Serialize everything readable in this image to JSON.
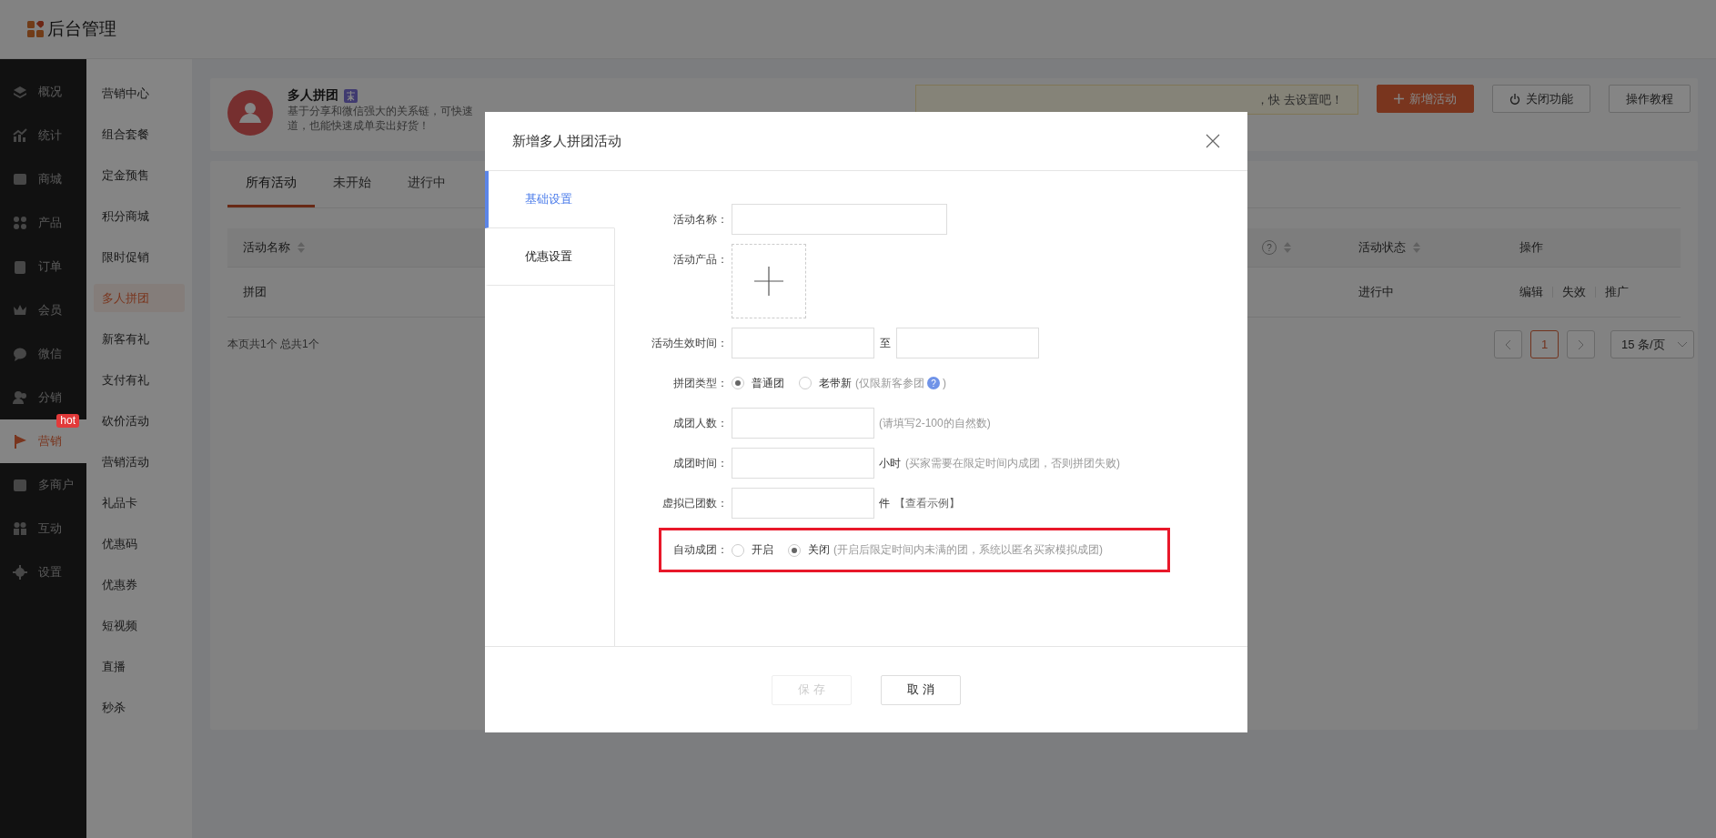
{
  "header": {
    "logo_text": "后台管理"
  },
  "sidebar": {
    "items": [
      {
        "label": "概况",
        "selected": false
      },
      {
        "label": "统计",
        "selected": false
      },
      {
        "label": "商城",
        "selected": false
      },
      {
        "label": "产品",
        "selected": false
      },
      {
        "label": "订单",
        "selected": false
      },
      {
        "label": "会员",
        "selected": false
      },
      {
        "label": "微信",
        "selected": false
      },
      {
        "label": "分销",
        "selected": false
      },
      {
        "label": "营销",
        "selected": true,
        "badge": "hot"
      },
      {
        "label": "多商户",
        "selected": false
      },
      {
        "label": "互动",
        "selected": false
      },
      {
        "label": "设置",
        "selected": false
      }
    ]
  },
  "submenu": {
    "items": [
      {
        "label": "营销中心",
        "selected": false
      },
      {
        "label": "组合套餐",
        "selected": false
      },
      {
        "label": "定金预售",
        "selected": false
      },
      {
        "label": "积分商城",
        "selected": false
      },
      {
        "label": "限时促销",
        "selected": false
      },
      {
        "label": "多人拼团",
        "selected": true
      },
      {
        "label": "新客有礼",
        "selected": false
      },
      {
        "label": "支付有礼",
        "selected": false
      },
      {
        "label": "砍价活动",
        "selected": false
      },
      {
        "label": "营销活动",
        "selected": false
      },
      {
        "label": "礼品卡",
        "selected": false
      },
      {
        "label": "优惠码",
        "selected": false
      },
      {
        "label": "优惠券",
        "selected": false
      },
      {
        "label": "短视频",
        "selected": false
      },
      {
        "label": "直播",
        "selected": false
      },
      {
        "label": "秒杀",
        "selected": false
      }
    ]
  },
  "activity_header": {
    "title": "多人拼团",
    "description": [
      "基于分享和微信强大的关系链，可快速",
      "道，也能快速成单卖出好货！"
    ],
    "notice": "，快 去设置吧！",
    "buttons": [
      {
        "label": "新增活动",
        "kind": "primary"
      },
      {
        "label": "关闭功能",
        "kind": "power"
      },
      {
        "label": "操作教程",
        "kind": "plain"
      }
    ]
  },
  "tabs": [
    {
      "label": "所有活动",
      "selected": true
    },
    {
      "label": "未开始",
      "selected": false
    },
    {
      "label": "进行中",
      "selected": false
    }
  ],
  "table": {
    "columns": [
      {
        "label": "活动名称",
        "sortable": true
      },
      {
        "help": "?",
        "sortable": true
      },
      {
        "label": "活动状态",
        "sortable": true
      },
      {
        "label": "操作",
        "sortable": false
      }
    ],
    "rows": [
      {
        "name": "拼团",
        "status": "进行中",
        "actions": [
          "编辑",
          "失效",
          "推广"
        ]
      }
    ]
  },
  "summary": "本页共1个 总共1个",
  "pagination": {
    "pages": [
      {
        "label": "1",
        "selected": true
      }
    ],
    "page_size": "15 条/页"
  },
  "modal": {
    "title": "新增多人拼团活动",
    "tabs": [
      {
        "label": "基础设置",
        "selected": true
      },
      {
        "label": "优惠设置",
        "selected": false
      }
    ],
    "fields": [
      {
        "kind": "input",
        "label": "活动名称："
      },
      {
        "kind": "upload",
        "label": "活动产品："
      },
      {
        "kind": "range",
        "label": "活动生效时间：",
        "separator": "至"
      },
      {
        "kind": "radio",
        "label": "拼团类型：",
        "highlighted": false,
        "options": [
          {
            "label": "普通团",
            "selected": true
          },
          {
            "label": "老带新",
            "selected": false,
            "note": "(仅限新客参团",
            "help": "?",
            "note_end": ")"
          }
        ]
      },
      {
        "kind": "short",
        "label": "成团人数：",
        "hint": "(请填写2-100的自然数)"
      },
      {
        "kind": "short",
        "label": "成团时间：",
        "unit": "小时",
        "hint": "(买家需要在限定时间内成团，否则拼团失败)"
      },
      {
        "kind": "short",
        "label": "虚拟已团数：",
        "unit": "件",
        "link": "【查看示例】"
      },
      {
        "kind": "radio",
        "label": "自动成团：",
        "highlighted": true,
        "options": [
          {
            "label": "开启",
            "selected": false
          },
          {
            "label": "关闭",
            "selected": true,
            "note": "(开启后限定时间内未满的团，系统以匿名买家模拟成团)"
          }
        ]
      }
    ],
    "buttons": [
      {
        "label": "保 存",
        "disabled": true
      },
      {
        "label": "取 消",
        "disabled": false
      }
    ]
  }
}
